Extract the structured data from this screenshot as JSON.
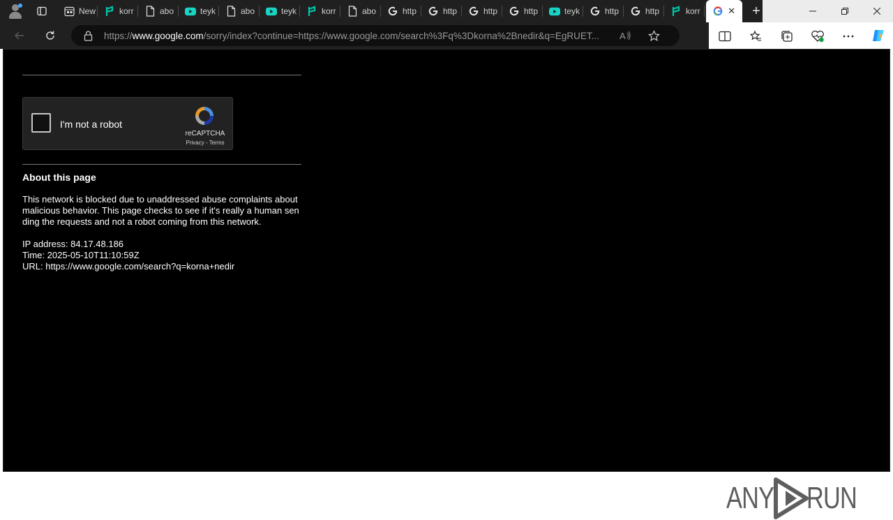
{
  "tabs": [
    {
      "icon": "newtab-icon",
      "label": "New"
    },
    {
      "icon": "korna-icon",
      "label": "korr"
    },
    {
      "icon": "document-icon",
      "label": "abo"
    },
    {
      "icon": "youtube-icon",
      "label": "teyk"
    },
    {
      "icon": "document-icon",
      "label": "abo"
    },
    {
      "icon": "youtube-icon",
      "label": "teyk"
    },
    {
      "icon": "korna-icon",
      "label": "korr"
    },
    {
      "icon": "document-icon",
      "label": "abo"
    },
    {
      "icon": "google-icon",
      "label": "http"
    },
    {
      "icon": "google-icon",
      "label": "http"
    },
    {
      "icon": "google-icon",
      "label": "http"
    },
    {
      "icon": "google-icon",
      "label": "http"
    },
    {
      "icon": "youtube-icon",
      "label": "teyk"
    },
    {
      "icon": "google-icon",
      "label": "http"
    },
    {
      "icon": "google-icon",
      "label": "http"
    },
    {
      "icon": "korna-icon",
      "label": "korr"
    }
  ],
  "address_bar": {
    "prefix": "https://",
    "host": "www.google.com",
    "path": "/sorry/index?continue=https://www.google.com/search%3Fq%3Dkorna%2Bnedir&q=EgRUET..."
  },
  "captcha": {
    "label": "I'm not a robot",
    "brand": "reCAPTCHA",
    "legal": "Privacy - Terms"
  },
  "about": {
    "title": "About this page",
    "text": "This network is blocked due to unaddressed abuse complaints about malicious behavior. This page checks to see if it's really a human sending the requests and not a robot coming from this network.",
    "ip": "IP address: 84.17.48.186",
    "time": "Time: 2025-05-10T11:10:59Z",
    "url": "URL: https://www.google.com/search?q=korna+nedir"
  },
  "watermark": {
    "left": "ANY",
    "right": "RUN"
  },
  "colors": {
    "chrome_dark": "#202020",
    "page_bg": "#000000",
    "accent_teal": "#00c3a7",
    "youtube_teal": "#19d3c5"
  }
}
